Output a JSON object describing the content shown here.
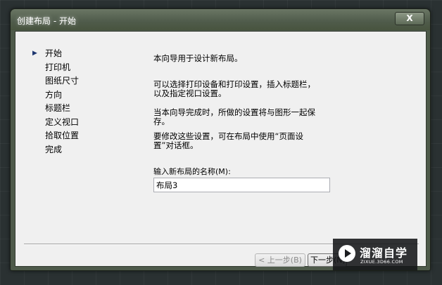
{
  "window": {
    "title": "创建布局 - 开始",
    "close_label": "X"
  },
  "steps": [
    {
      "label": "开始",
      "current": true
    },
    {
      "label": "打印机"
    },
    {
      "label": "图纸尺寸"
    },
    {
      "label": "方向"
    },
    {
      "label": "标题栏"
    },
    {
      "label": "定义视口"
    },
    {
      "label": "拾取位置"
    },
    {
      "label": "完成"
    }
  ],
  "current_step_marker": "▶",
  "content": {
    "intro": "本向导用于设计新布局。",
    "para_1": "可以选择打印设备和打印设置，插入标题栏，\n以及指定视口设置。",
    "para_2": "当本向导完成时，所做的设置将与图形一起保\n存。",
    "para_3": "要修改这些设置，可在布局中使用“页面设\n置”对话框。"
  },
  "name_field": {
    "label": "输入新布局的名称(M):",
    "value": "布局3"
  },
  "buttons": {
    "back": "< 上一步(B)",
    "next": "下一步(N) >"
  },
  "watermark": {
    "brand": "溜溜自学",
    "url": "ZIXUE.3D66.COM"
  },
  "colors": {
    "title_bar": "#4f5b4b",
    "dialog_bg": "#f0f0f0",
    "step_marker": "#1e3770"
  }
}
